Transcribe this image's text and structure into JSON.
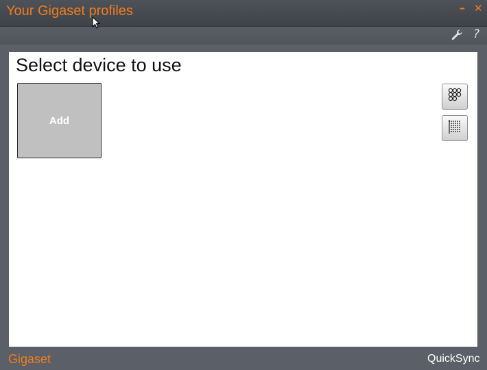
{
  "window": {
    "title": "Your Gigaset profiles",
    "minimize_symbol": "–",
    "close_symbol": "✕",
    "accent_color": "#f07d1e"
  },
  "toolbar": {
    "settings_icon": "wrench-icon",
    "help_symbol": "?"
  },
  "main": {
    "heading": "Select device to use",
    "add_tile_label": "Add",
    "view_buttons": [
      {
        "icon": "grid-view-icon"
      },
      {
        "icon": "list-view-icon"
      }
    ]
  },
  "footer": {
    "brand": "Gigaset",
    "product": "QuickSync"
  }
}
